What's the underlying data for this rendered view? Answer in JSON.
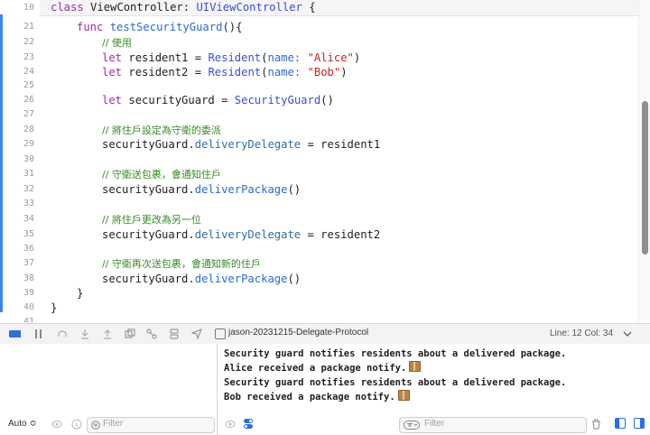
{
  "editor": {
    "header_line": {
      "num": "10",
      "kw": "class",
      "name": "ViewController",
      "colon": ":",
      "super": "UIViewController",
      "brace": "{"
    },
    "line_numbers": [
      "21",
      "22",
      "23",
      "24",
      "25",
      "26",
      "27",
      "28",
      "29",
      "30",
      "31",
      "32",
      "33",
      "34",
      "35",
      "36",
      "37",
      "38",
      "39",
      "40",
      "41"
    ],
    "code": {
      "func_kw": "func",
      "func_name": "testSecurityGuard",
      "func_tail": "(){",
      "c_use": "// 使用",
      "let": "let",
      "r1": "resident1",
      "r2": "resident2",
      "eq": "=",
      "resident_type": "Resident",
      "open_paren": "(",
      "name_label": "name:",
      "close_paren": ")",
      "alice": "\"Alice\"",
      "bob": "\"Bob\"",
      "sg": "securityGuard",
      "sg_type": "SecurityGuard",
      "empty_call": "()",
      "c_set": "// 將住戶設定為守衛的委派",
      "delegate_prop": "deliveryDelegate",
      "dot": ".",
      "c_deliver": "// 守衛送包裹，會通知住戶",
      "deliver_fn": "deliverPackage",
      "c_change": "// 將住戶更改為另一位",
      "c_deliver2": "// 守衛再次送包裹，會通知新的住戶",
      "close_brace": "}"
    }
  },
  "debug_bar": {
    "scheme": "jason-20231215-Delegate-Protocol",
    "cursor": "Line: 12  Col: 34"
  },
  "console": {
    "lines": [
      "Security guard notifies residents about a delivered package.",
      "Alice received a package notify.",
      "Security guard notifies residents about a delivered package.",
      "Bob received a package notify."
    ],
    "filter_placeholder": "Filter"
  },
  "variables": {
    "scope": "Auto ≎",
    "filter_placeholder": "Filter"
  },
  "colors": {
    "accent": "#3b82f6",
    "keyword": "#a52aa8",
    "string": "#c4261d",
    "comment": "#3a8a2a"
  }
}
